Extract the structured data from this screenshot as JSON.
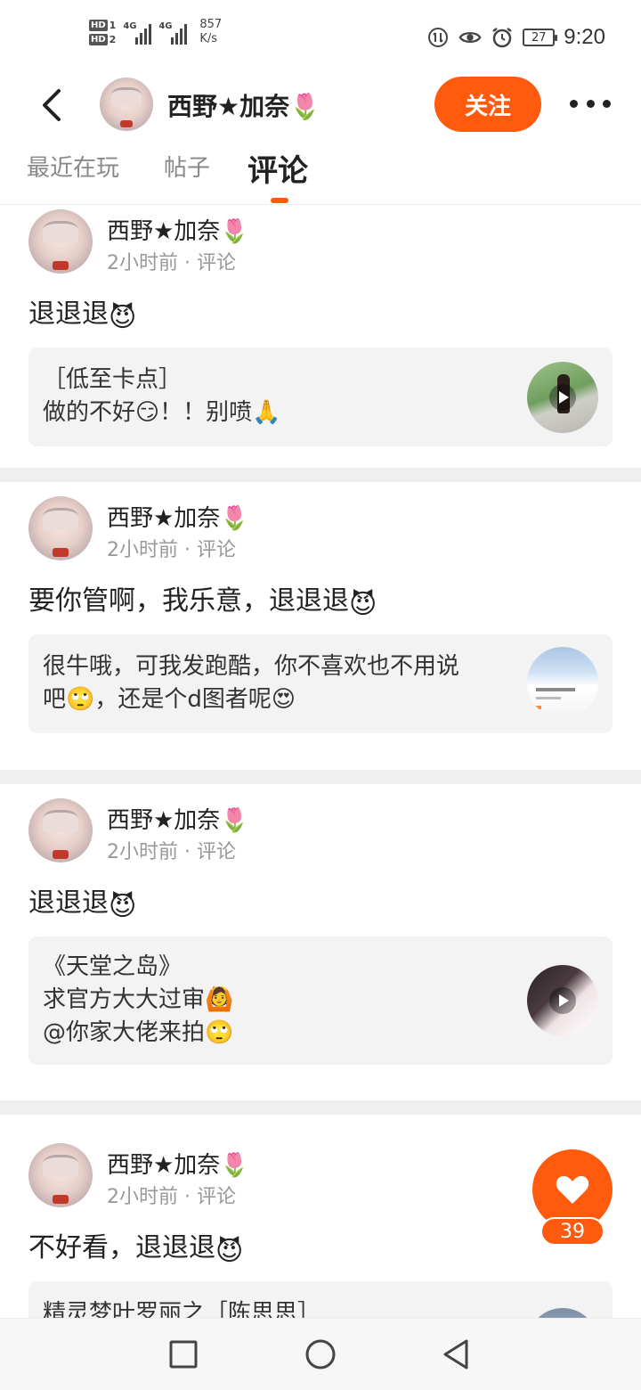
{
  "status_bar": {
    "hd1": "HD",
    "hd1_num": "1",
    "hd2": "HD",
    "hd2_num": "2",
    "sig1_label": "4G",
    "sig2_label": "4G",
    "speed_value": "857",
    "speed_unit": "K/s",
    "battery": "27",
    "time": "9:20"
  },
  "header": {
    "user_name": "西野★加奈🌷",
    "follow_label": "关注"
  },
  "tabs": [
    {
      "label": "最近在玩"
    },
    {
      "label": "帖子"
    },
    {
      "label": "评论"
    }
  ],
  "posts": [
    {
      "name": "西野★加奈🌷",
      "meta": "2小时前 · 评论",
      "text": "退退退",
      "text_emoji": "😈",
      "quote_lines": [
        "［低至卡点］",
        "做的不好😏！！别喷🙏"
      ]
    },
    {
      "name": "西野★加奈🌷",
      "meta": "2小时前 · 评论",
      "text": "要你管啊，我乐意，退退退",
      "text_emoji": "😈",
      "quote_lines": [
        "很牛哦，可我发跑酷，你不喜欢也不用说",
        "吧🙄，还是个d图者呢😍"
      ]
    },
    {
      "name": "西野★加奈🌷",
      "meta": "2小时前 · 评论",
      "text": "退退退",
      "text_emoji": "😈",
      "quote_lines": [
        "《天堂之岛》",
        "求官方大大过审🙆",
        "@你家大佬来拍🙄"
      ]
    },
    {
      "name": "西野★加奈🌷",
      "meta": "2小时前 · 评论",
      "text": "不好看，退退退",
      "text_emoji": "😈",
      "quote_lines": [
        "精灵梦叶罗丽之［陈思思］"
      ]
    }
  ],
  "like": {
    "count": "39"
  },
  "colors": {
    "accent": "#ff5a0e",
    "quote_bg": "#f3f3f3",
    "separator": "#f0f0f0"
  },
  "icons": {
    "back": "chevron-left-icon",
    "more": "more-dots-icon",
    "like": "heart-icon",
    "play": "play-icon",
    "nav_recent": "square-icon",
    "nav_home": "circle-icon",
    "nav_back": "triangle-back-icon"
  }
}
